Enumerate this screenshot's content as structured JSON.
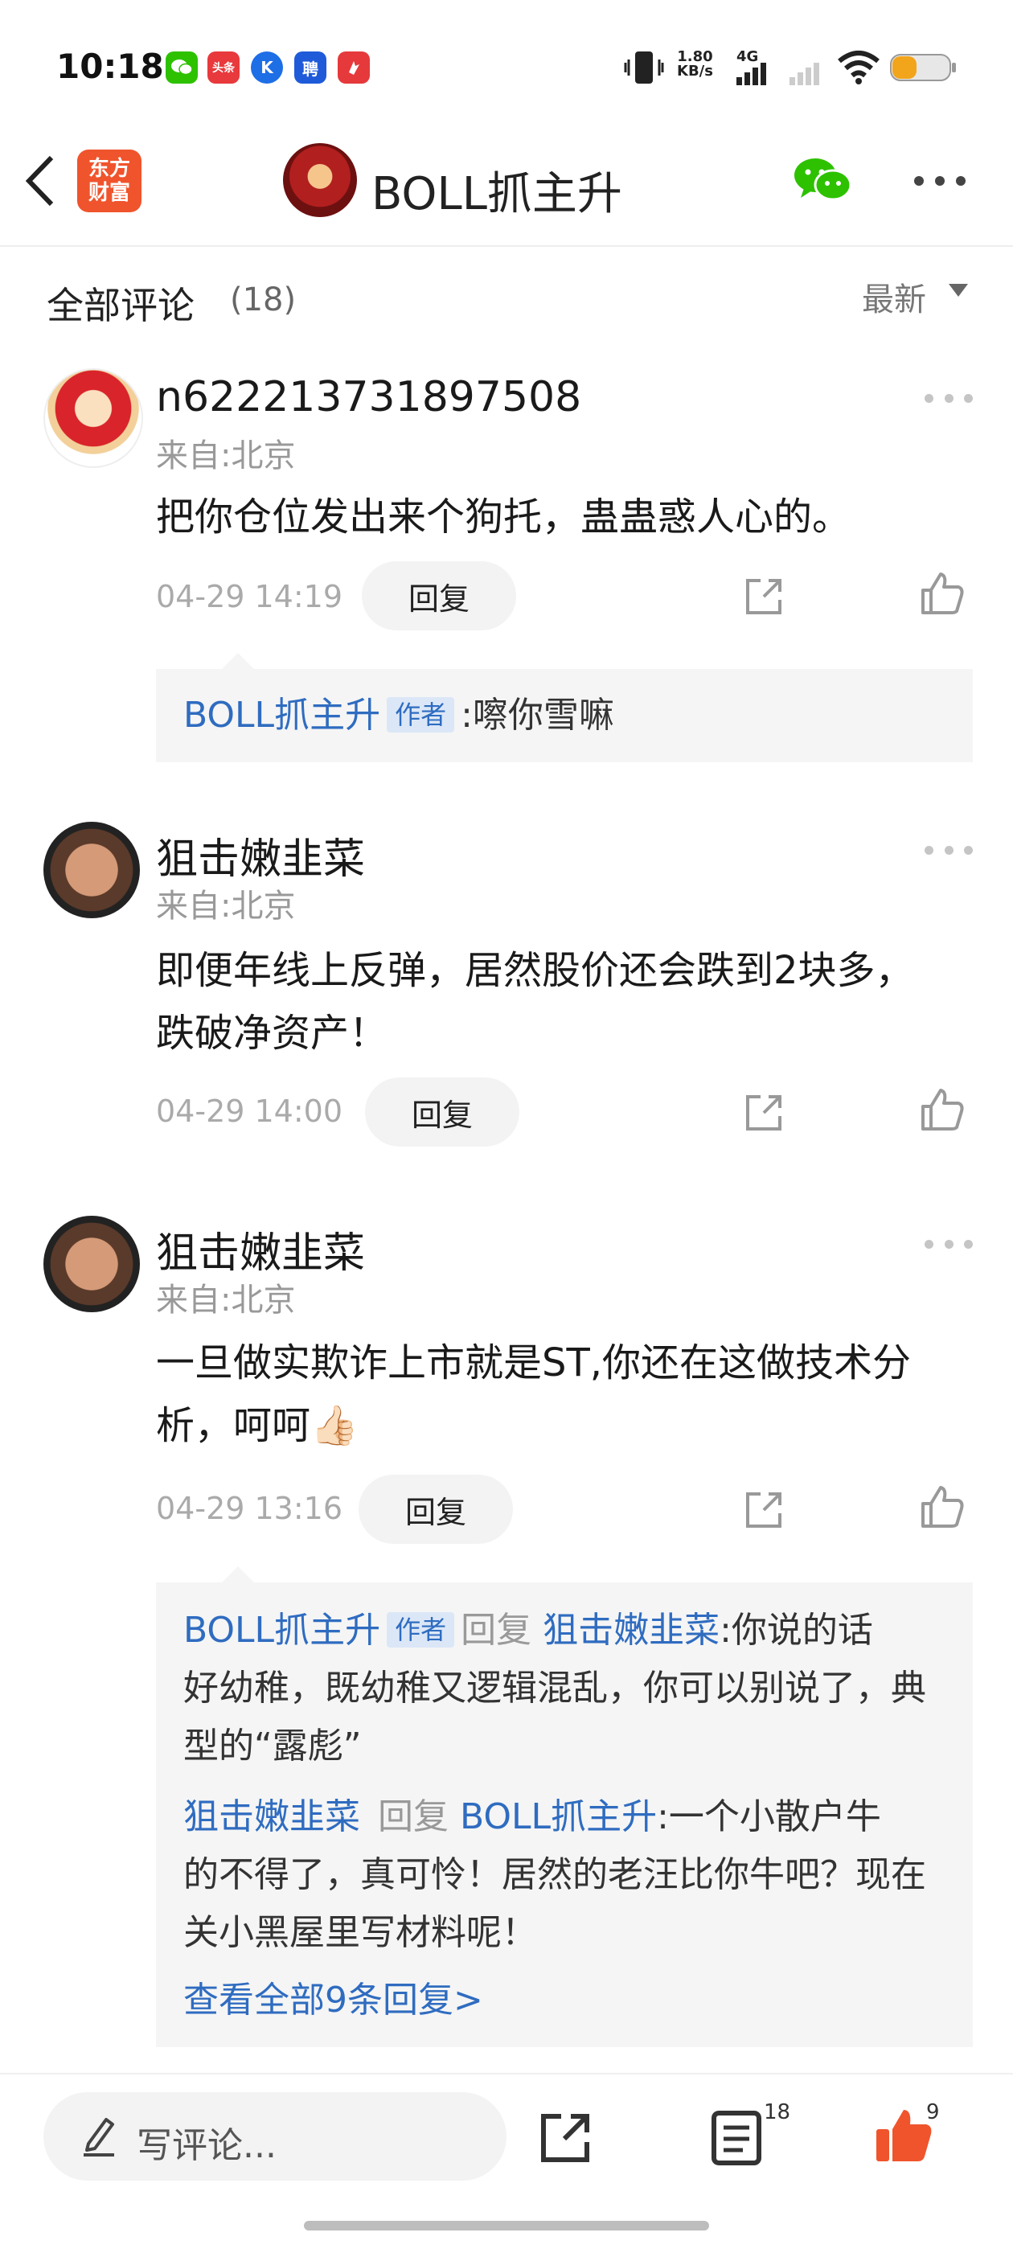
{
  "status_bar": {
    "time": "10:18",
    "net_speed_value": "1.80",
    "net_speed_unit": "KB/s",
    "network_type": "4G",
    "app_icons": [
      {
        "name": "wechat-icon",
        "color": "#2dc100"
      },
      {
        "name": "toutiao-icon",
        "label": "头条",
        "color": "#e8393c"
      },
      {
        "name": "kuaishou-icon",
        "label": "K",
        "color": "#1e6ee6"
      },
      {
        "name": "zhaopin-icon",
        "label": "聘",
        "color": "#1f5bd9"
      },
      {
        "name": "app-icon-red",
        "color": "#e5393b"
      }
    ]
  },
  "nav": {
    "logo_text_line1": "东方",
    "logo_text_line2": "财富",
    "title": "BOLL抓主升",
    "logo_color": "#f0542c",
    "wechat_color": "#2dc100"
  },
  "comments_header": {
    "title": "全部评论",
    "count": "(18)",
    "sort_label": "最新"
  },
  "comments": [
    {
      "username": "n622213731897508",
      "from": "来自:北京",
      "text": "把你仓位发出来个狗托，蛊蛊惑人心的。",
      "time": "04-29 14:19",
      "reply_label": "回复",
      "replies": [
        {
          "user": "BOLL抓主升",
          "tag": "作者",
          "content": ":嚓你雪嘛"
        }
      ]
    },
    {
      "username": "狙击嫩韭菜",
      "from": "来自:北京",
      "text_line1": "即便年线上反弹，居然股价还会跌到2块多，",
      "text_line2": "跌破净资产！",
      "time": "04-29 14:00",
      "reply_label": "回复"
    },
    {
      "username": "狙击嫩韭菜",
      "from": "来自:北京",
      "text_line1": "一旦做实欺诈上市就是ST,你还在这做技术分",
      "text_line2": "析，呵呵👍🏻",
      "time": "04-29 13:16",
      "reply_label": "回复",
      "replies": [
        {
          "user": "BOLL抓主升",
          "tag": "作者",
          "reply_word": "回复",
          "target": "狙击嫩韭菜",
          "line1": ":你说的话",
          "line2": "好幼稚，既幼稚又逻辑混乱，你可以别说了，典",
          "line3": "型的“露彪”"
        },
        {
          "user": "狙击嫩韭菜",
          "reply_word": "回复",
          "target": "BOLL抓主升",
          "line1": ":一个小散户牛",
          "line2": "的不得了，真可怜！居然的老汪比你牛吧？现在",
          "line3": "关小黑屋里写材料呢！"
        }
      ],
      "view_all": "查看全部9条回复>"
    }
  ],
  "bottom_bar": {
    "placeholder": "写评论...",
    "comment_badge": "18",
    "like_badge": "9",
    "like_color": "#f0542c"
  }
}
